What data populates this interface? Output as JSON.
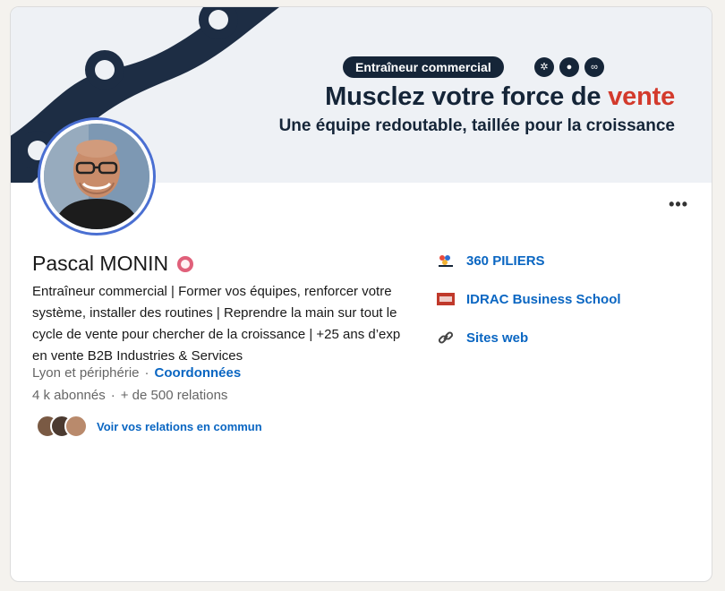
{
  "banner": {
    "badge": "Entraîneur commercial",
    "headline_main": "Musclez votre force de ",
    "headline_accent": "vente",
    "subline": "Une équipe redoutable, taillée pour la croissance",
    "colors": {
      "navy": "#152538",
      "accent": "#d33a2c",
      "background": "#eef1f5"
    },
    "icons": [
      "network-icon",
      "bullets-icon",
      "chain-link-icon"
    ]
  },
  "profile": {
    "name": "Pascal MONIN",
    "bio": "Entraîneur commercial | Former vos équipes, renforcer votre système, installer des routines | Reprendre la main sur tout le cycle de vente pour chercher de la croissance | +25 ans d’exp en vente B2B Industries & Services",
    "location": "Lyon et périphérie",
    "contact_link": "Coordonnées",
    "followers": "4 k abonnés",
    "relations": "+ de 500 relations",
    "mutual_link": "Voir vos relations en commun"
  },
  "sidebar": {
    "items": [
      {
        "label": "360 PILIERS",
        "icon": "company-logo-icon"
      },
      {
        "label": "IDRAC Business School",
        "icon": "school-logo-icon"
      },
      {
        "label": "Sites web",
        "icon": "link-icon"
      }
    ]
  },
  "menu": {
    "more_label": "•••"
  }
}
